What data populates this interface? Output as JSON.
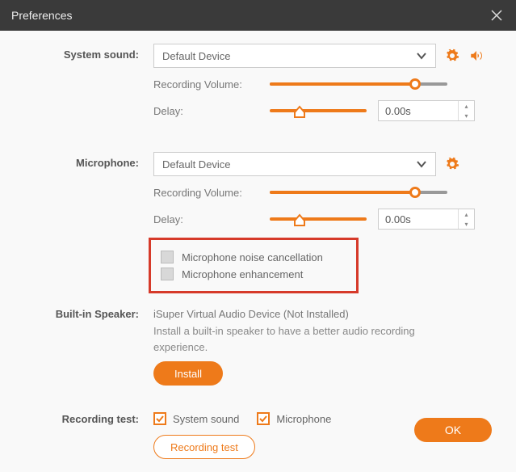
{
  "window": {
    "title": "Preferences"
  },
  "colors": {
    "accent": "#ee7a1a",
    "highlight_border": "#d63a2a"
  },
  "system_sound": {
    "label": "System sound:",
    "device": "Default Device",
    "recording_volume_label": "Recording Volume:",
    "recording_volume_pct": 82,
    "delay_label": "Delay:",
    "delay_value": "0.00s",
    "delay_slider_pct": 30
  },
  "microphone": {
    "label": "Microphone:",
    "device": "Default Device",
    "recording_volume_label": "Recording Volume:",
    "recording_volume_pct": 82,
    "delay_label": "Delay:",
    "delay_value": "0.00s",
    "delay_slider_pct": 30,
    "noise_cancel_label": "Microphone noise cancellation",
    "noise_cancel_checked": false,
    "enhance_label": "Microphone enhancement",
    "enhance_checked": false
  },
  "speaker": {
    "label": "Built-in Speaker:",
    "status": "iSuper Virtual Audio Device (Not Installed)",
    "desc": "Install a built-in speaker to have a better audio recording experience.",
    "install_label": "Install"
  },
  "recording_test": {
    "label": "Recording test:",
    "system_sound_label": "System sound",
    "system_sound_checked": true,
    "microphone_label": "Microphone",
    "microphone_checked": true,
    "button_label": "Recording test"
  },
  "footer": {
    "ok_label": "OK"
  }
}
